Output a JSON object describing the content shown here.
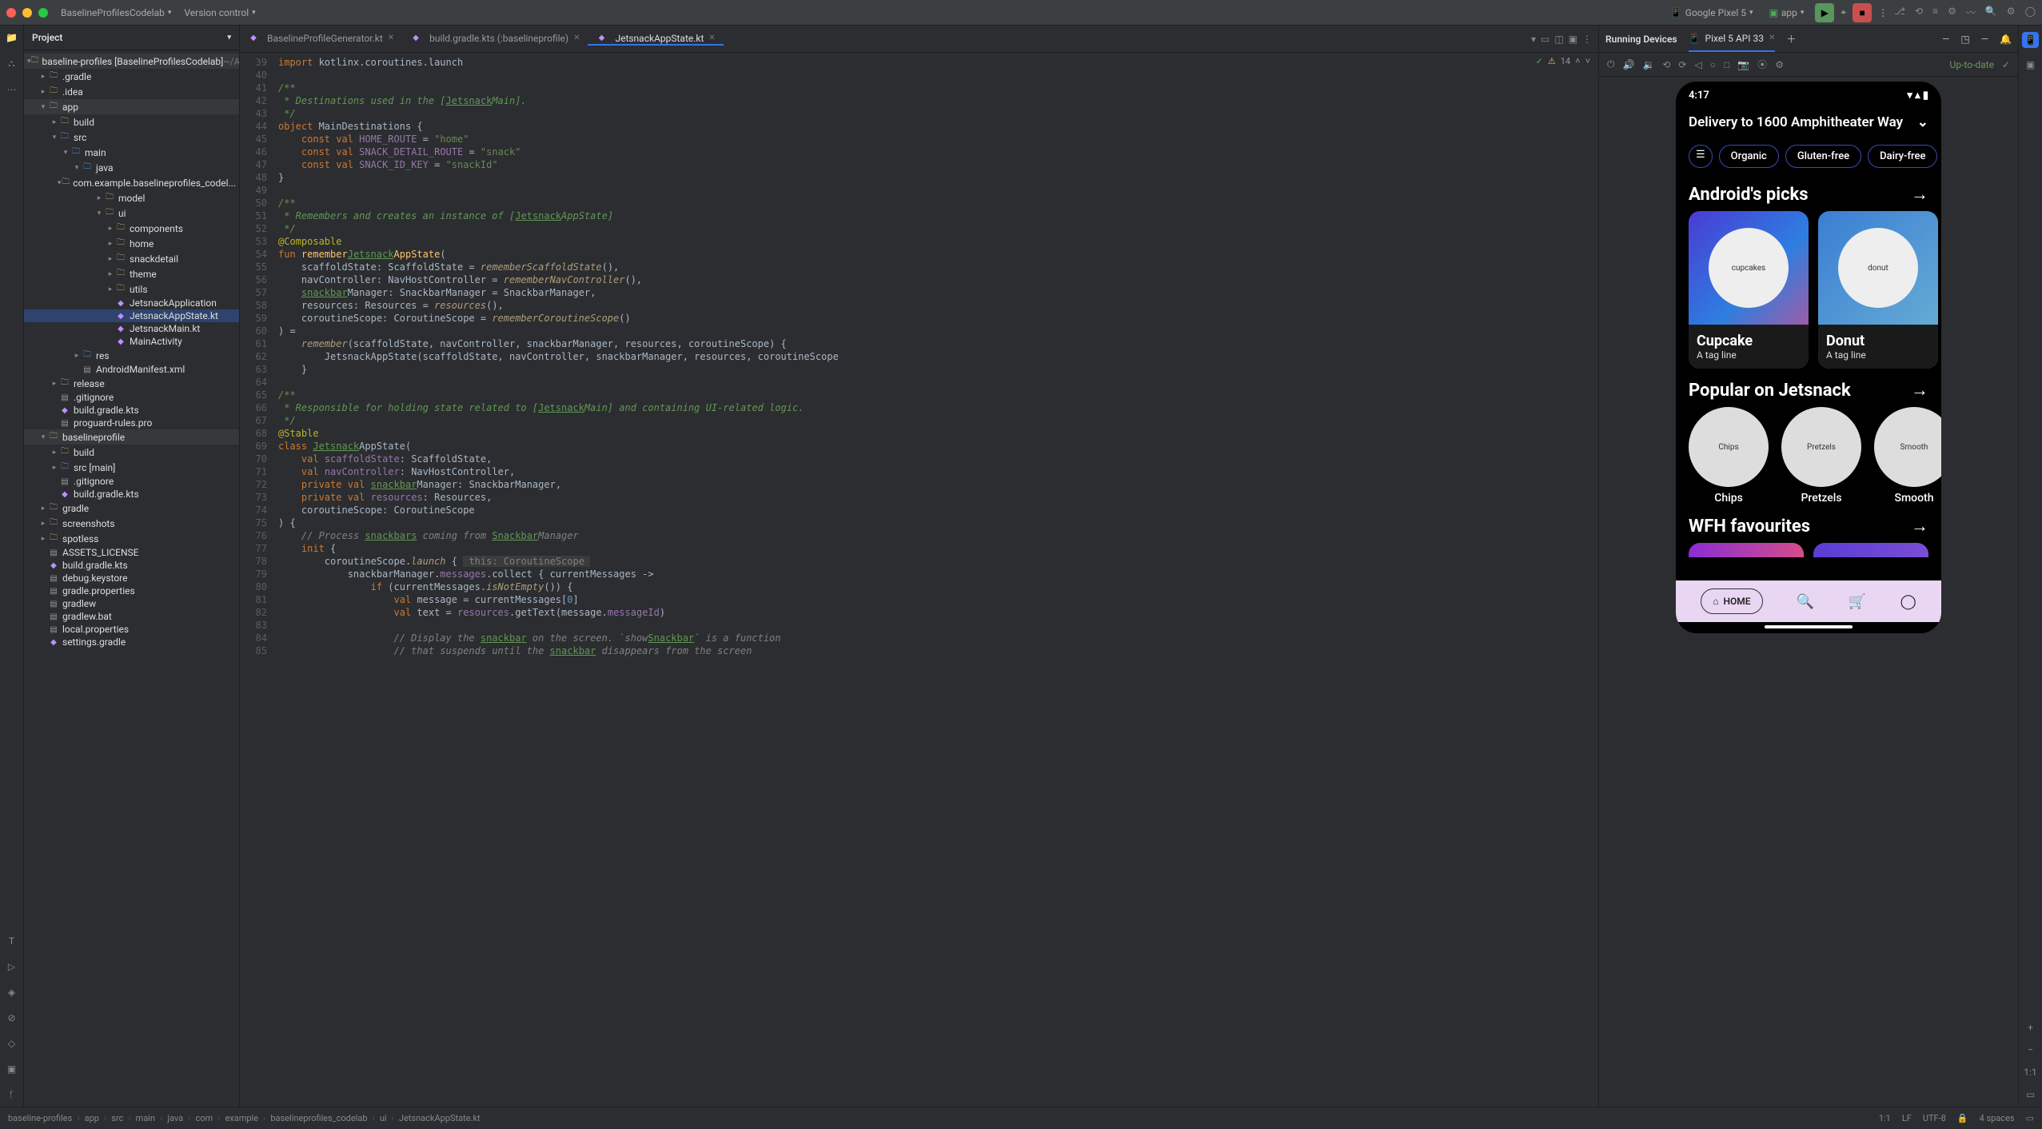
{
  "titlebar": {
    "project_name": "BaselineProfilesCodelab",
    "vcs_label": "Version control",
    "device": "Google Pixel 5",
    "run_config": "app"
  },
  "project_panel": {
    "title": "Project"
  },
  "tree": [
    {
      "d": 0,
      "c": "v",
      "i": "folder",
      "t": "baseline-profiles [BaselineProfilesCodelab]",
      "x": " ~/And...",
      "mod": true
    },
    {
      "d": 1,
      "c": ">",
      "i": "folder",
      "t": ".gradle"
    },
    {
      "d": 1,
      "c": ">",
      "i": "folder",
      "t": ".idea"
    },
    {
      "d": 1,
      "c": "v",
      "i": "folder",
      "t": "app",
      "mod": true
    },
    {
      "d": 2,
      "c": ">",
      "i": "folder",
      "t": "build"
    },
    {
      "d": 2,
      "c": "v",
      "i": "src",
      "t": "src"
    },
    {
      "d": 3,
      "c": "v",
      "i": "src",
      "t": "main"
    },
    {
      "d": 4,
      "c": "v",
      "i": "src",
      "t": "java"
    },
    {
      "d": 5,
      "c": "v",
      "i": "folder",
      "t": "com.example.baselineprofiles_codel..."
    },
    {
      "d": 6,
      "c": ">",
      "i": "folder",
      "t": "model"
    },
    {
      "d": 6,
      "c": "v",
      "i": "folder",
      "t": "ui"
    },
    {
      "d": 7,
      "c": ">",
      "i": "folder",
      "t": "components"
    },
    {
      "d": 7,
      "c": ">",
      "i": "folder",
      "t": "home"
    },
    {
      "d": 7,
      "c": ">",
      "i": "folder",
      "t": "snackdetail"
    },
    {
      "d": 7,
      "c": ">",
      "i": "folder",
      "t": "theme"
    },
    {
      "d": 7,
      "c": ">",
      "i": "folder",
      "t": "utils"
    },
    {
      "d": 7,
      "c": " ",
      "i": "kfile",
      "t": "JetsnackApplication"
    },
    {
      "d": 7,
      "c": " ",
      "i": "kfile",
      "t": "JetsnackAppState.kt",
      "sel": true
    },
    {
      "d": 7,
      "c": " ",
      "i": "kfile",
      "t": "JetsnackMain.kt"
    },
    {
      "d": 7,
      "c": " ",
      "i": "kfile",
      "t": "MainActivity"
    },
    {
      "d": 4,
      "c": ">",
      "i": "src",
      "t": "res"
    },
    {
      "d": 4,
      "c": " ",
      "i": "json",
      "t": "AndroidManifest.xml"
    },
    {
      "d": 2,
      "c": ">",
      "i": "folder",
      "t": "release"
    },
    {
      "d": 2,
      "c": " ",
      "i": "json",
      "t": ".gitignore"
    },
    {
      "d": 2,
      "c": " ",
      "i": "kfile",
      "t": "build.gradle.kts"
    },
    {
      "d": 2,
      "c": " ",
      "i": "json",
      "t": "proguard-rules.pro"
    },
    {
      "d": 1,
      "c": "v",
      "i": "folder",
      "t": "baselineprofile",
      "mod": true
    },
    {
      "d": 2,
      "c": ">",
      "i": "folder",
      "t": "build"
    },
    {
      "d": 2,
      "c": ">",
      "i": "src",
      "t": "src [main]"
    },
    {
      "d": 2,
      "c": " ",
      "i": "json",
      "t": ".gitignore"
    },
    {
      "d": 2,
      "c": " ",
      "i": "kfile",
      "t": "build.gradle.kts"
    },
    {
      "d": 1,
      "c": ">",
      "i": "folder",
      "t": "gradle"
    },
    {
      "d": 1,
      "c": ">",
      "i": "folder",
      "t": "screenshots"
    },
    {
      "d": 1,
      "c": ">",
      "i": "folder",
      "t": "spotless"
    },
    {
      "d": 1,
      "c": " ",
      "i": "json",
      "t": "ASSETS_LICENSE"
    },
    {
      "d": 1,
      "c": " ",
      "i": "kfile",
      "t": "build.gradle.kts"
    },
    {
      "d": 1,
      "c": " ",
      "i": "json",
      "t": "debug.keystore"
    },
    {
      "d": 1,
      "c": " ",
      "i": "json",
      "t": "gradle.properties"
    },
    {
      "d": 1,
      "c": " ",
      "i": "json",
      "t": "gradlew"
    },
    {
      "d": 1,
      "c": " ",
      "i": "json",
      "t": "gradlew.bat"
    },
    {
      "d": 1,
      "c": " ",
      "i": "json",
      "t": "local.properties"
    },
    {
      "d": 1,
      "c": " ",
      "i": "kfile",
      "t": "settings.gradle"
    }
  ],
  "tabs": [
    {
      "label": "BaselineProfileGenerator.kt",
      "icon": "kfile"
    },
    {
      "label": "build.gradle.kts (:baselineprofile)",
      "icon": "kfile"
    },
    {
      "label": "JetsnackAppState.kt",
      "icon": "kfile",
      "active": true
    }
  ],
  "inspection": {
    "count": "14"
  },
  "code_start_line": 39,
  "code_lines": [
    "<span class='kw'>import</span> kotlinx.coroutines.launch",
    "",
    "<span class='doc'>/**</span>",
    "<span class='doc'> * Destinations used in the [</span><span class='link'>Jetsnack</span><span class='doc'>Main].</span>",
    "<span class='doc'> */</span>",
    "<span class='kw'>object</span> MainDestinations {",
    "    <span class='kw'>const val</span> <span class='field'>HOME_ROUTE</span> = <span class='str'>\"home\"</span>",
    "    <span class='kw'>const val</span> <span class='field'>SNACK_DETAIL_ROUTE</span> = <span class='str'>\"snack\"</span>",
    "    <span class='kw'>const val</span> <span class='field'>SNACK_ID_KEY</span> = <span class='str'>\"snackId\"</span>",
    "}",
    "",
    "<span class='doc'>/**</span>",
    "<span class='doc'> * Remembers and creates an instance of [</span><span class='link'>Jetsnack</span><span class='doc'>AppState]</span>",
    "<span class='doc'> */</span>",
    "<span class='anno'>@Composable</span>",
    "<span class='kw'>fun</span> <span class='fn'>remember</span><span class='link'>Jetsnack</span><span class='fn'>AppState</span>(",
    "    scaffoldState: ScaffoldState = <span class='call'>rememberScaffoldState</span>(),",
    "    navController: NavHostController = <span class='call'>rememberNavController</span>(),",
    "    <span class='link'>snackbar</span>Manager: SnackbarManager = SnackbarManager,",
    "    resources: Resources = <span class='call'>resources</span>(),",
    "    coroutineScope: CoroutineScope = <span class='call'>rememberCoroutineScope</span>()",
    ") =",
    "    <span class='call'>remember</span>(scaffoldState, navController, snackbarManager, resources, coroutineScope) {",
    "        JetsnackAppState(scaffoldState, navController, snackbarManager, resources, coroutineScope",
    "    }",
    "",
    "<span class='doc'>/**</span>",
    "<span class='doc'> * Responsible for holding state related to [</span><span class='link'>Jetsnack</span><span class='doc'>Main] and containing UI-related logic.</span>",
    "<span class='doc'> */</span>",
    "<span class='anno'>@Stable</span>",
    "<span class='kw'>class</span> <span class='link'>Jetsnack</span>AppState(",
    "    <span class='kw'>val</span> <span class='field'>scaffoldState</span>: ScaffoldState,",
    "    <span class='kw'>val</span> <span class='field'>navController</span>: NavHostController,",
    "    <span class='kw'>private val</span> <span class='link'>snackbar</span>Manager: SnackbarManager,",
    "    <span class='kw'>private val</span> <span class='field'>resources</span>: Resources,",
    "    coroutineScope: CoroutineScope",
    ") {",
    "    <span class='cmt'>// Process </span><span class='link'>snackbars</span><span class='cmt'> coming from </span><span class='link'>Snackbar</span><span class='cmt'>Manager</span>",
    "    <span class='kw'>init</span> {",
    "        coroutineScope.<span class='call'>launch</span> { <span class='cmt' style='background:#3b3b3b;font-style:normal'> this: CoroutineScope </span>",
    "            snackbarManager.<span class='field'>messages</span>.collect { currentMessages -&gt;",
    "                <span class='kw'>if</span> (currentMessages.<span class='call'>isNotEmpty</span>()) {",
    "                    <span class='kw'>val</span> message = currentMessages[<span class='num'>0</span>]",
    "                    <span class='kw'>val</span> text = <span class='field'>resources</span>.getText(message.<span class='field'>messageId</span>)",
    "",
    "                    <span class='cmt'>// Display the </span><span class='link'>snackbar</span><span class='cmt'> on the screen. `show</span><span class='link'>Snackbar</span><span class='cmt'>` is a function</span>",
    "                    <span class='cmt'>// that suspends until the </span><span class='link'>snackbar</span><span class='cmt'> disappears from the screen</span>"
  ],
  "device_panel": {
    "title": "Running Devices",
    "tab": "Pixel 5 API 33",
    "uptodate": "Up-to-date"
  },
  "phone": {
    "time": "4:17",
    "address": "Delivery to 1600 Amphitheater Way",
    "chips": [
      "Organic",
      "Gluten-free",
      "Dairy-free"
    ],
    "section1": "Android's picks",
    "cards": [
      {
        "title": "Cupcake",
        "sub": "A tag line",
        "img": "cupcakes"
      },
      {
        "title": "Donut",
        "sub": "A tag line",
        "img": "donut"
      }
    ],
    "section2": "Popular on Jetsnack",
    "circles": [
      "Chips",
      "Pretzels",
      "Smooth"
    ],
    "section3": "WFH favourites",
    "nav_home": "HOME"
  },
  "breadcrumbs": [
    "baseline-profiles",
    "app",
    "src",
    "main",
    "java",
    "com",
    "example",
    "baselineprofiles_codelab",
    "ui",
    "JetsnackAppState.kt"
  ],
  "status": {
    "pos": "1:1",
    "le": "LF",
    "enc": "UTF-8",
    "indent": "4 spaces"
  }
}
